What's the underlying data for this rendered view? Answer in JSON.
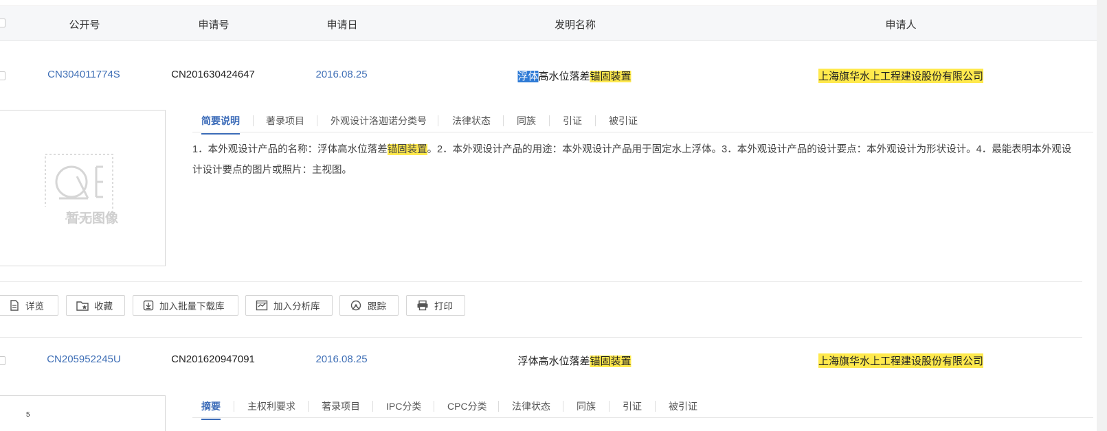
{
  "header": {
    "col_pub": "公开号",
    "col_app": "申请号",
    "col_date": "申请日",
    "col_title": "发明名称",
    "col_applicant": "申请人"
  },
  "records": [
    {
      "pub_no": "CN304011774S",
      "app_no": "CN201630424647",
      "app_date": "2016.08.25",
      "title_part1": "浮体",
      "title_part2": "高水位落差",
      "title_part3": "锚固装置",
      "applicant": "上海旗华水上工程建设股份有限公司",
      "thumb_text": "暂无图像",
      "tabs": [
        "简要说明",
        "著录项目",
        "外观设计洛迦诺分类号",
        "法律状态",
        "同族",
        "引证",
        "被引证"
      ],
      "desc_part1": "1．本外观设计产品的名称：浮体高水位落差",
      "desc_highlight": "锚固装置",
      "desc_part2": "。2．本外观设计产品的用途：本外观设计产品用于固定水上浮体。3．本外观设计产品的设计要点：本外观设计为形状设计。4．最能表明本外观设计设计要点的图片或照片：主视图。"
    },
    {
      "pub_no": "CN205952245U",
      "app_no": "CN201620947091",
      "app_date": "2016.08.25",
      "title_part1": "浮体高水位落差",
      "title_part3": "锚固装置",
      "applicant": "上海旗华水上工程建设股份有限公司",
      "tabs": [
        "摘要",
        "主权利要求",
        "著录项目",
        "IPC分类",
        "CPC分类",
        "法律状态",
        "同族",
        "引证",
        "被引证"
      ],
      "thumb_mark": "5"
    }
  ],
  "actions": {
    "detail": "详览",
    "favorite": "收藏",
    "batch_download": "加入批量下载库",
    "analysis": "加入分析库",
    "track": "跟踪",
    "print": "打印"
  },
  "colors": {
    "link": "#3f6fb6",
    "highlight": "#ffe94d",
    "selection": "#2f7bd6",
    "tab_active": "#3b6bb8"
  }
}
